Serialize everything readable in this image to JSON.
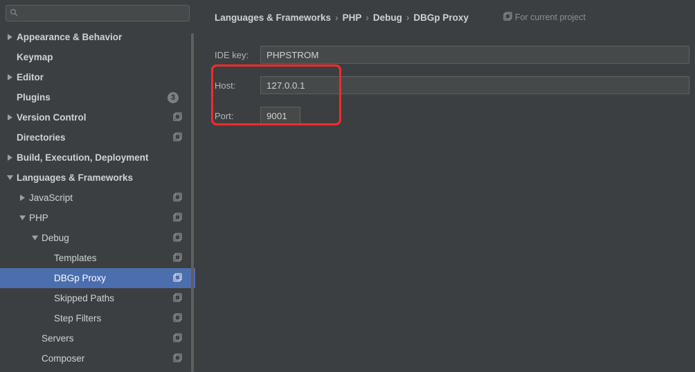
{
  "search": {
    "placeholder": ""
  },
  "tree": [
    {
      "id": "appearance",
      "label": "Appearance & Behavior",
      "indent": 0,
      "expand": "right",
      "bold": true
    },
    {
      "id": "keymap",
      "label": "Keymap",
      "indent": 0,
      "bold": true
    },
    {
      "id": "editor",
      "label": "Editor",
      "indent": 0,
      "expand": "right",
      "bold": true
    },
    {
      "id": "plugins",
      "label": "Plugins",
      "indent": 0,
      "bold": true,
      "count": "3"
    },
    {
      "id": "vcs",
      "label": "Version Control",
      "indent": 0,
      "expand": "right",
      "bold": true,
      "stack": true
    },
    {
      "id": "dirs",
      "label": "Directories",
      "indent": 0,
      "bold": true,
      "stack": true
    },
    {
      "id": "build",
      "label": "Build, Execution, Deployment",
      "indent": 0,
      "expand": "right",
      "bold": true
    },
    {
      "id": "lang",
      "label": "Languages & Frameworks",
      "indent": 0,
      "expand": "down",
      "bold": true
    },
    {
      "id": "js",
      "label": "JavaScript",
      "indent": 1,
      "expand": "right",
      "stack": true
    },
    {
      "id": "php",
      "label": "PHP",
      "indent": 1,
      "expand": "down",
      "stack": true
    },
    {
      "id": "debug",
      "label": "Debug",
      "indent": 2,
      "expand": "down",
      "stack": true
    },
    {
      "id": "templates",
      "label": "Templates",
      "indent": 3,
      "stack": true
    },
    {
      "id": "dbgp",
      "label": "DBGp Proxy",
      "indent": 3,
      "stack": true,
      "selected": true
    },
    {
      "id": "skip",
      "label": "Skipped Paths",
      "indent": 3,
      "stack": true
    },
    {
      "id": "step",
      "label": "Step Filters",
      "indent": 3,
      "stack": true
    },
    {
      "id": "servers",
      "label": "Servers",
      "indent": 2,
      "stack": true
    },
    {
      "id": "composer",
      "label": "Composer",
      "indent": 2,
      "stack": true
    }
  ],
  "breadcrumbs": [
    "Languages & Frameworks",
    "PHP",
    "Debug",
    "DBGp Proxy"
  ],
  "sep_glyph": "›",
  "for_project_label": "For current project",
  "form": {
    "ide_key": {
      "label": "IDE key:",
      "value": "PHPSTROM"
    },
    "host": {
      "label": "Host:",
      "value": "127.0.0.1"
    },
    "port": {
      "label": "Port:",
      "value": "9001"
    }
  }
}
